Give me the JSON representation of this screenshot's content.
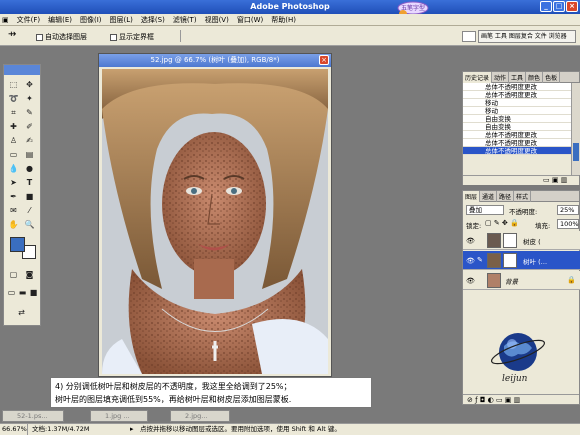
{
  "app": {
    "title": "Adobe Photoshop"
  },
  "logo": {
    "text": "五笔字型"
  },
  "menu": [
    "文件(F)",
    "编辑(E)",
    "图像(I)",
    "图层(L)",
    "选择(S)",
    "滤镜(T)",
    "视图(V)",
    "窗口(W)",
    "帮助(H)"
  ],
  "options": {
    "auto_select": "自动选择图层",
    "show_bbox": "显示定界框",
    "palette_well": "画笔 工具 图层复合 文件 浏览器"
  },
  "document": {
    "title": "52.jpg @ 66.7% (树叶 (叠加), RGB/8*)"
  },
  "history": {
    "tabs": [
      "历史记录",
      "动作",
      "工具",
      "颜色",
      "色板"
    ],
    "items": [
      "总体不透明度更改",
      "总体不透明度更改",
      "移动",
      "移动",
      "自由变换",
      "自由变换",
      "总体不透明度更改",
      "总体不透明度更改",
      "总体不透明度更改"
    ]
  },
  "layers_panel": {
    "tabs": [
      "图层",
      "通道",
      "路径",
      "样式"
    ],
    "blend_mode": "叠加",
    "opacity_label": "不透明度:",
    "opacity": "25%",
    "lock_label": "锁定:",
    "fill_label": "填充:",
    "fill": "100%",
    "layers": [
      {
        "name": "树皮 (",
        "selected": false
      },
      {
        "name": "树叶 (…",
        "selected": true
      },
      {
        "name": "背景",
        "selected": false
      }
    ]
  },
  "watermark": {
    "text": "leijun"
  },
  "caption": {
    "line1": "4) 分别调低树叶层和树皮层的不透明度，我这里全给调到了25%；",
    "line2": "树叶层的图层填充调低到55%，再给树叶层和树皮层添加图层蒙板."
  },
  "taskbar": [
    "52-1.ps...",
    "1.jpg ...",
    "2.jpg..."
  ],
  "status": {
    "zoom": "66.67%",
    "doc": "文档:1.37M/4.72M",
    "hint": "点按并拖移以移动图层或选区。要用附加选项，使用 Shift 和 Alt 键。"
  },
  "colors": {
    "selection": "#2a55c8",
    "titlebar": "#1f4fb8",
    "foreground": "#3a6ec0",
    "background": "#ffffff"
  }
}
